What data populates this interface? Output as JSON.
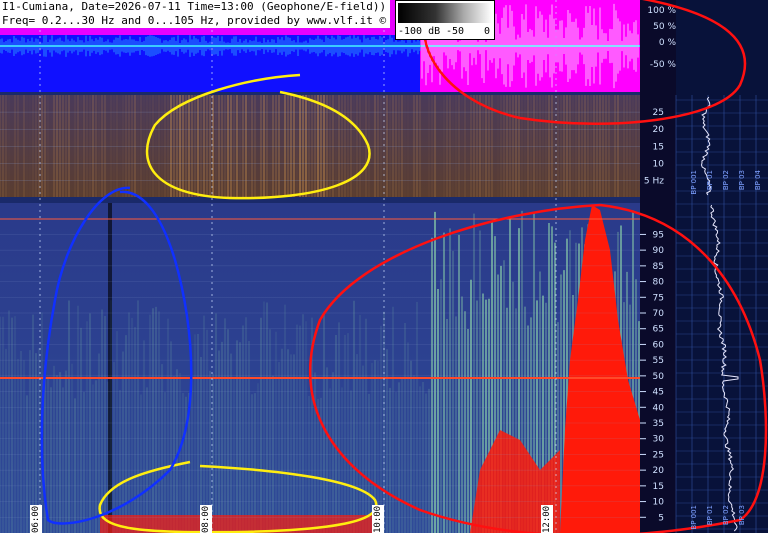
{
  "header": {
    "line1": "I1-Cumiana, Date=2026-07-11 Time=13:00 (Geophone/E-field))",
    "line2": "Freq= 0.2...30 Hz and 0...105 Hz, provided by www.vlf.it ©"
  },
  "db_scale": {
    "min_label": "-100 dB",
    "mid_label": "-50",
    "max_label": "0"
  },
  "time_axis": {
    "labels": [
      "06:00",
      "08:00",
      "10:00",
      "12:00"
    ]
  },
  "side_labels": [
    "BP 001",
    "BP 01",
    "BP 02",
    "BP 03",
    "BP 04",
    "BP 001",
    "BP 01",
    "BP 02",
    "BP 03"
  ],
  "colors": {
    "panel_background": "#243a86",
    "amplitude_background": "#1010ff",
    "pink_band": "#ff00ff",
    "red_energy": "#ff1a0a",
    "annotation_red": "#ff1010",
    "annotation_yellow": "#ffee10",
    "annotation_blue": "#1030ff"
  },
  "chart_data": [
    {
      "type": "heatmap",
      "panel": "amplitude",
      "yticks": [
        "100 %",
        "50 %",
        "0 %",
        "-50 %"
      ]
    },
    {
      "type": "heatmap",
      "panel": "spectrogram-low",
      "ylabel": "Hz",
      "yticks": [
        25,
        20,
        15,
        10,
        5
      ],
      "ylim": [
        0.2,
        30
      ]
    },
    {
      "type": "heatmap",
      "panel": "spectrogram-high",
      "yticks": [
        95,
        90,
        85,
        80,
        75,
        70,
        65,
        60,
        55,
        50,
        45,
        40,
        35,
        30,
        25,
        20,
        15,
        10,
        5
      ],
      "ylim": [
        0,
        105
      ]
    }
  ]
}
